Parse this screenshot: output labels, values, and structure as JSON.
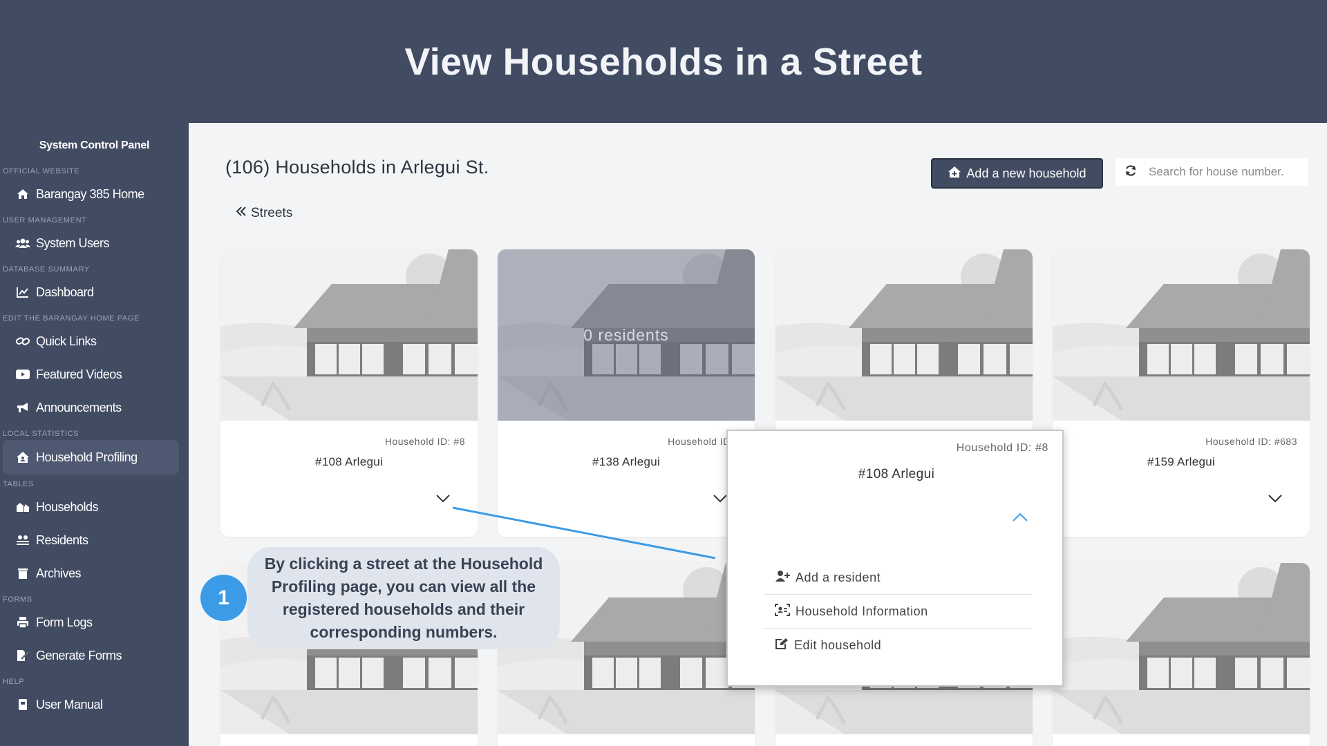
{
  "banner": {
    "title": "View Households in a Street"
  },
  "sidebar": {
    "panel_title": "System Control Panel",
    "sections": [
      {
        "label": "OFFICIAL WEBSITE",
        "items": [
          {
            "label": "Barangay 385 Home",
            "icon": "home-icon"
          }
        ]
      },
      {
        "label": "USER MANAGEMENT",
        "items": [
          {
            "label": "System Users",
            "icon": "users-icon"
          }
        ]
      },
      {
        "label": "DATABASE SUMMARY",
        "items": [
          {
            "label": "Dashboard",
            "icon": "chart-line-icon"
          }
        ]
      },
      {
        "label": "EDIT THE BARANGAY HOME PAGE",
        "items": [
          {
            "label": "Quick Links",
            "icon": "link-icon"
          },
          {
            "label": "Featured Videos",
            "icon": "youtube-icon"
          },
          {
            "label": "Announcements",
            "icon": "bullhorn-icon"
          }
        ]
      },
      {
        "label": "LOCAL STATISTICS",
        "items": [
          {
            "label": "Household Profiling",
            "icon": "house-user-icon",
            "active": true
          }
        ]
      },
      {
        "label": "TABLES",
        "items": [
          {
            "label": "Households",
            "icon": "houses-icon"
          },
          {
            "label": "Residents",
            "icon": "people-icon"
          },
          {
            "label": "Archives",
            "icon": "trash-icon"
          }
        ]
      },
      {
        "label": "FORMS",
        "items": [
          {
            "label": "Form Logs",
            "icon": "printer-icon"
          },
          {
            "label": "Generate Forms",
            "icon": "file-signature-icon"
          }
        ]
      },
      {
        "label": "HELP",
        "items": [
          {
            "label": "User Manual",
            "icon": "book-icon"
          }
        ]
      }
    ]
  },
  "main": {
    "title": "(106) Households in Arlegui St.",
    "add_button": "Add a new household",
    "search_placeholder": "Search for house number.",
    "back_link": "Streets",
    "cards": [
      {
        "household_id": "Household ID: #8",
        "address": "#108 Arlegui"
      },
      {
        "household_id": "Household ID: #",
        "address": "#138 Arlegui",
        "overlay": "0 residents"
      },
      {
        "household_id": "",
        "address": ""
      },
      {
        "household_id": "Household ID: #683",
        "address": "#159 Arlegui"
      }
    ]
  },
  "popup": {
    "household_id": "Household ID: #8",
    "address": "#108 Arlegui",
    "menu": {
      "add_resident": "Add a resident",
      "household_info": "Household Information",
      "edit": "Edit household"
    }
  },
  "callout": {
    "step": "1",
    "text": "By clicking a street at the Household Profiling page, you can view all the registered households and their corresponding numbers."
  },
  "colors": {
    "header": "#414b62",
    "accent_blue": "#3b9be6",
    "callout_bg": "#e0e4ec"
  }
}
